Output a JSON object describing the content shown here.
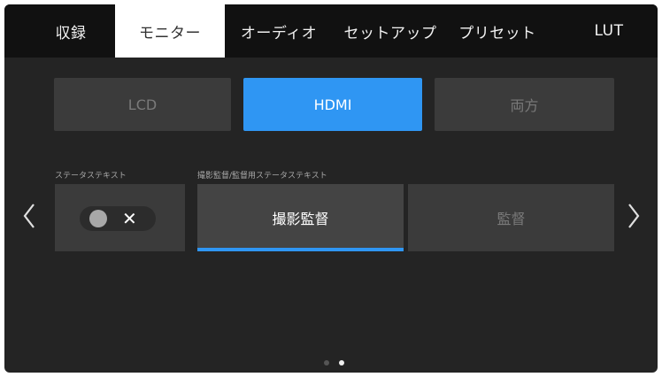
{
  "tabs": [
    {
      "label": "収録"
    },
    {
      "label": "モニター"
    },
    {
      "label": "オーディオ"
    },
    {
      "label": "セットアップ"
    },
    {
      "label": "プリセット"
    },
    {
      "label": "LUT"
    }
  ],
  "active_tab": "モニター",
  "output_selector": {
    "options": [
      "LCD",
      "HDMI",
      "両方"
    ],
    "selected": "HDMI"
  },
  "status_text": {
    "label": "ステータステキスト",
    "toggle_state": "off",
    "toggle_symbol": "✕"
  },
  "dp_status_text": {
    "label": "撮影監督/監督用ステータステキスト",
    "options": [
      "撮影監督",
      "監督"
    ],
    "selected": "撮影監督"
  },
  "pagination": {
    "current": 2,
    "total": 2
  },
  "colors": {
    "accent": "#2f96f3",
    "background": "#242424",
    "tabbar": "#111111",
    "button": "#3b3b3b"
  },
  "icons": {
    "prev": "chevron-left-icon",
    "next": "chevron-right-icon"
  }
}
